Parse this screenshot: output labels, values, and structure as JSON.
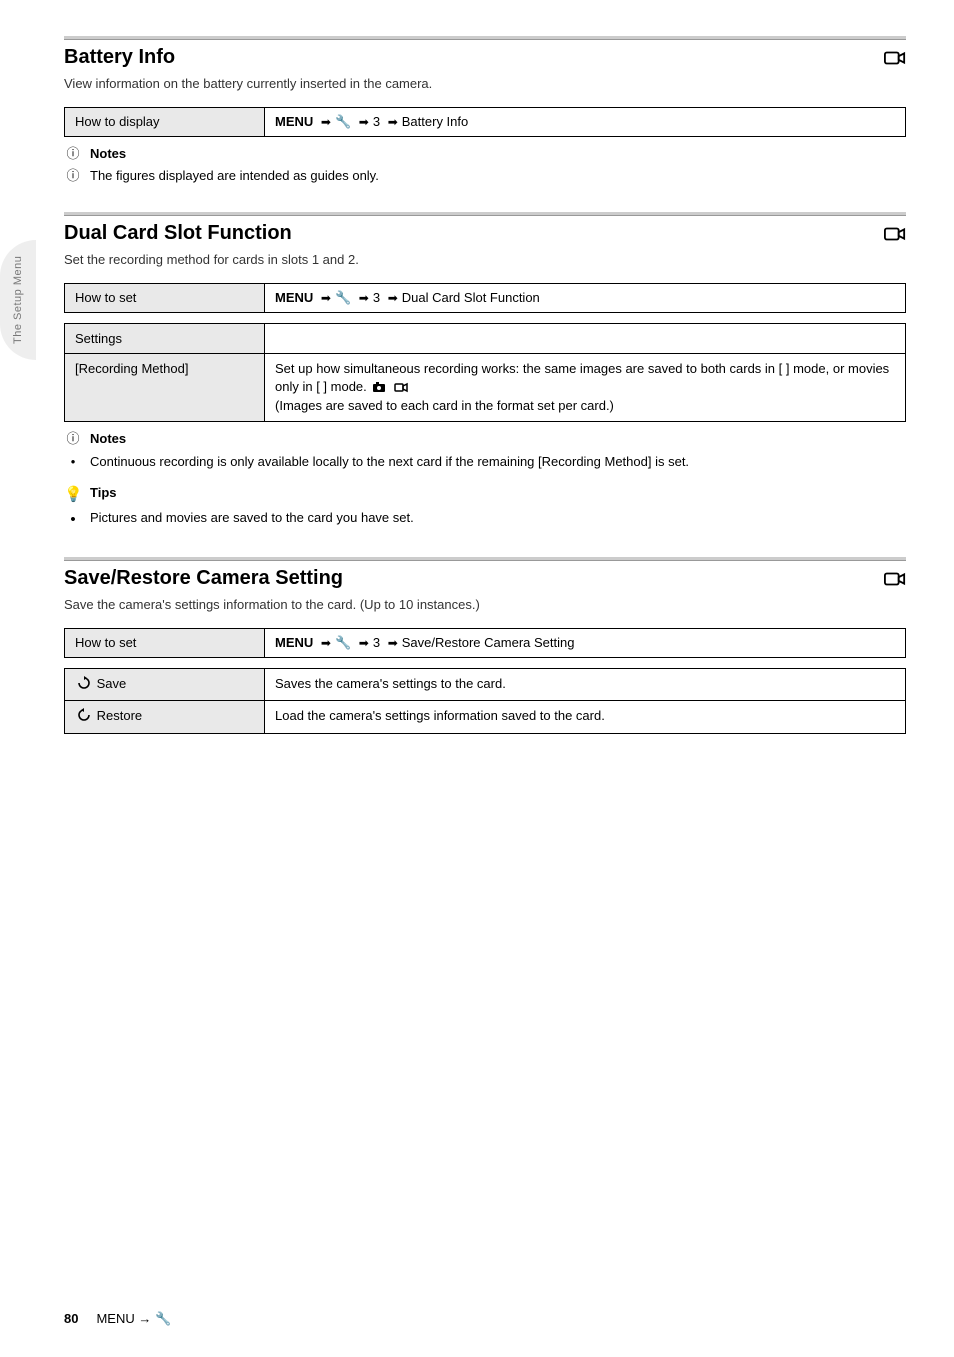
{
  "side_tab": "The Setup Menu",
  "sec1": {
    "title": "Battery Info",
    "desc": "View information on the battery currently inserted in the camera.",
    "menu_k": "How to display",
    "menu_v_pre": "MENU",
    "menu_v_steps": [
      "🔧",
      "3",
      "Battery Info"
    ],
    "note1": "Notes",
    "note2": "The figures displayed are intended as guides only."
  },
  "sec2": {
    "title": "Dual Card Slot Function",
    "desc": "Set the recording method for cards in slots 1 and 2.",
    "menu_k": "How to set",
    "menu_v_pre": "MENU",
    "menu_v_steps": [
      "🔧",
      "3",
      "Dual Card Slot Function"
    ],
    "opts_header": "Settings",
    "opt1_k": "[Recording Method]",
    "opt1_v_line1": "Set up how simultaneous recording works: the same images are saved to both cards in [ ] mode, or movies only in [ ] mode.",
    "opt1_v_line2": "(Images are saved to each card in the format set per card.)",
    "note1": "Notes",
    "note2": "Continuous recording is only available locally to the next card if the remaining [Recording Method] is set.",
    "tip_glyph": "💡",
    "tip1": "Tips",
    "tip2": "Pictures and movies are saved to the card you have set."
  },
  "sec3": {
    "title": "Save/Restore Camera Setting",
    "desc": "Save the camera's settings information to the card. (Up to 10 instances.)",
    "menu_k": "How to set",
    "menu_v_pre": "MENU",
    "menu_v_steps": [
      "🔧",
      "3",
      "Save/Restore Camera Setting"
    ],
    "opt1_k": " Save",
    "opt1_v": "Saves the camera's settings to the card.",
    "opt2_k": " Restore",
    "opt2_v": "Load the camera's settings information saved to the card."
  },
  "footer": {
    "page": "80",
    "crumb": "MENU  →  🔧"
  }
}
